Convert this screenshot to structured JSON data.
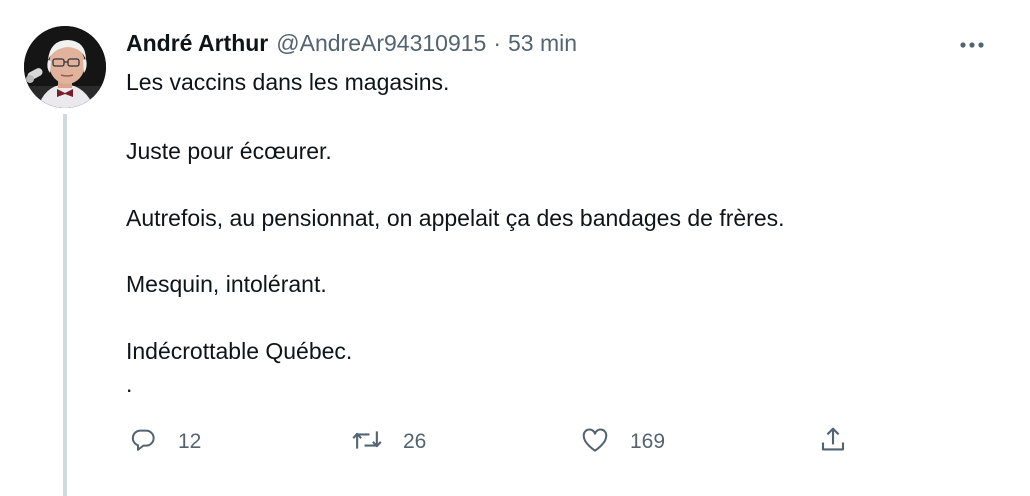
{
  "tweet": {
    "author": {
      "display_name": "André Arthur",
      "handle": "@AndreAr94310915",
      "separator": "·",
      "time": "53 min"
    },
    "lines": [
      "Les vaccins dans les magasins.",
      "Juste pour écœurer.",
      "Autrefois, au pensionnat, on appelait ça des bandages de frères.",
      "Mesquin, intolérant.",
      "Indécrottable Québec.",
      "."
    ],
    "actions": {
      "replies": "12",
      "retweets": "26",
      "likes": "169"
    },
    "icons": {
      "more": "more-horizontal-icon",
      "reply": "reply-icon",
      "retweet": "retweet-icon",
      "like": "heart-icon",
      "share": "share-icon"
    },
    "colors": {
      "text": "#0f1419",
      "secondary": "#536471",
      "thread_line": "#cfd9de"
    }
  }
}
